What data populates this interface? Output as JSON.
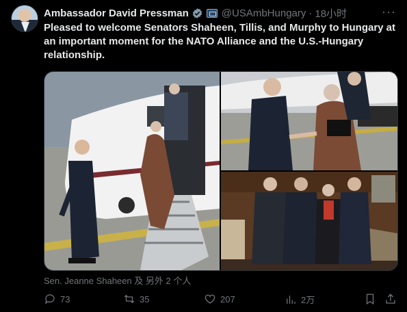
{
  "author": {
    "display_name": "Ambassador David Pressman",
    "handle": "@USAmbHungary",
    "separator": "·",
    "time": "18小时",
    "more_label": "···"
  },
  "tweet": {
    "text": "Pleased to welcome Senators Shaheen, Tillis, and Murphy to Hungary at an important moment for the NATO Alliance and the U.S.-Hungary relationship."
  },
  "media": {
    "photos": [
      "airplane-arrival-photo",
      "handshake-photo",
      "group-photo"
    ]
  },
  "caption": "Sen. Jeanne Shaheen 及 另外 2 个人",
  "actions": {
    "replies": "73",
    "retweets": "35",
    "likes": "207",
    "views": "2万"
  },
  "colors": {
    "background": "#000000",
    "text": "#e7e9ea",
    "muted": "#71767b",
    "verified": "#829aab"
  }
}
